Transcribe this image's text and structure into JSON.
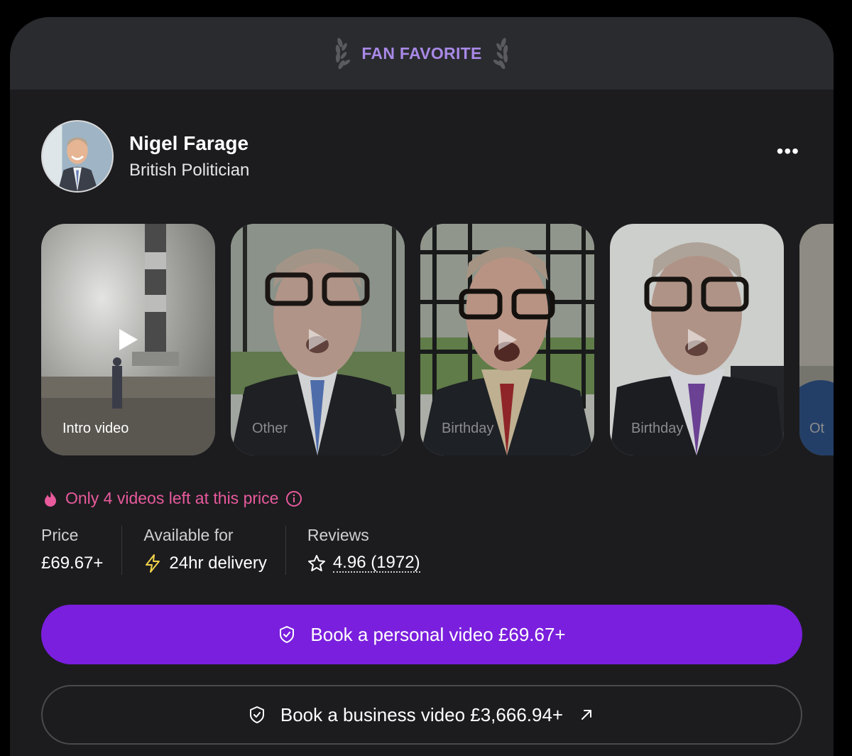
{
  "banner": {
    "label": "FAN FAVORITE",
    "color": "#a889e6"
  },
  "profile": {
    "name": "Nigel Farage",
    "title": "British Politician",
    "more_icon": "more-horizontal-icon"
  },
  "videos": [
    {
      "label": "Intro video",
      "state": "active"
    },
    {
      "label": "Other",
      "state": "dim"
    },
    {
      "label": "Birthday",
      "state": "dim"
    },
    {
      "label": "Birthday",
      "state": "dim"
    },
    {
      "label": "Ot",
      "state": "partial"
    }
  ],
  "scarcity": {
    "text": "Only 4 videos left at this price",
    "color": "#e85a9c",
    "icon": "fire-icon"
  },
  "stats": {
    "price": {
      "label": "Price",
      "value": "£69.67+"
    },
    "availability": {
      "label": "Available for",
      "value": "24hr delivery",
      "icon": "lightning-icon"
    },
    "reviews": {
      "label": "Reviews",
      "value": "4.96 (1972)",
      "icon": "star-icon"
    }
  },
  "buttons": {
    "personal": {
      "label": "Book a personal video £69.67+",
      "icon": "shield-check-icon",
      "color": "#7a1fdd"
    },
    "business": {
      "label": "Book a business video £3,666.94+",
      "icon": "shield-check-icon",
      "trailing_icon": "arrow-up-right-icon"
    }
  }
}
